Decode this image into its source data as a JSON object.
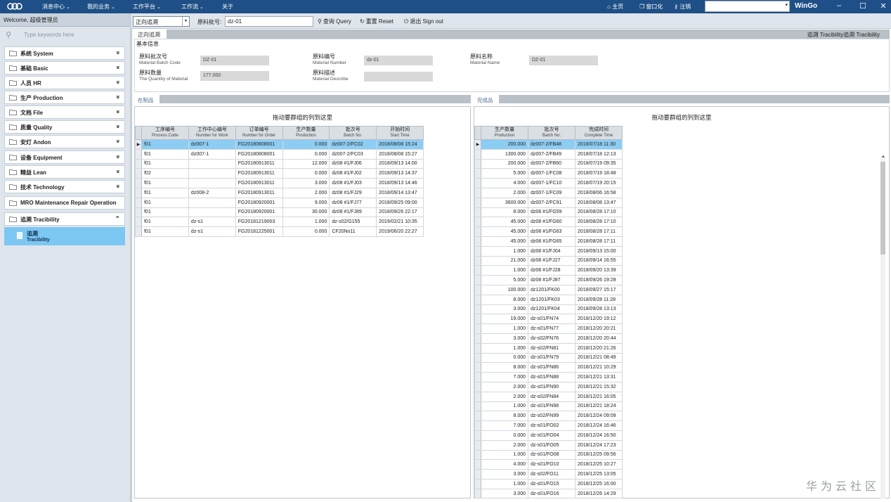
{
  "topbar": {
    "menus": [
      "消息中心",
      "我的业务",
      "工作平台",
      "工作流",
      "关于"
    ],
    "home": "主页",
    "windowize": "窗口化",
    "logout": "注销",
    "brand": "WinGo"
  },
  "sidebar": {
    "welcome": "Welcome, 超级管理员",
    "search_placeholder": "Type keywords here",
    "items": [
      {
        "zh": "系统",
        "en": "System"
      },
      {
        "zh": "基础",
        "en": "Basic"
      },
      {
        "zh": "人员",
        "en": "HR"
      },
      {
        "zh": "生产",
        "en": "Production"
      },
      {
        "zh": "文档",
        "en": "File"
      },
      {
        "zh": "质量",
        "en": "Quality"
      },
      {
        "zh": "安灯",
        "en": "Andon"
      },
      {
        "zh": "设备",
        "en": "Equipment"
      },
      {
        "zh": "精益",
        "en": "Lean"
      },
      {
        "zh": "技术",
        "en": "Technology"
      },
      {
        "zh": "MRO",
        "en": "Maintenance Repair Operation"
      },
      {
        "zh": "追溯",
        "en": "Tracibility"
      }
    ],
    "sub_item": {
      "zh": "追溯",
      "en": "Tracibility"
    }
  },
  "toolbar": {
    "mode": "正向追溯",
    "batch_label": "原料批号:",
    "batch_value": "dz-01",
    "query": "查询 Query",
    "reset": "重置 Reset",
    "signout": "退出 Sign out"
  },
  "tabs": {
    "active": "正向追溯",
    "right": "追溯  Tracibility追溯  Tracibility"
  },
  "basic_info": {
    "title": "基本信息",
    "fields": [
      {
        "zh": "原料批次号",
        "en": "Material Batch Code",
        "value": "DZ-01"
      },
      {
        "zh": "原料编号",
        "en": "Material Number",
        "value": "dz-01"
      },
      {
        "zh": "原料名称",
        "en": "Material Name",
        "value": "DZ-01"
      },
      {
        "zh": "原料数量",
        "en": "The Quantity of Material",
        "value": "177.000"
      },
      {
        "zh": "原料描述",
        "en": "Material Describe",
        "value": ""
      }
    ]
  },
  "wip": {
    "tab": "在制品",
    "hint": "拖动要群组的列到这里",
    "columns": [
      {
        "zh": "工序编号",
        "en": "Process Code"
      },
      {
        "zh": "工作中心编号",
        "en": "Number for Work"
      },
      {
        "zh": "订单编号",
        "en": "Number for Order"
      },
      {
        "zh": "生产数量",
        "en": "Production"
      },
      {
        "zh": "批次号",
        "en": "Batch No."
      },
      {
        "zh": "开始时间",
        "en": "Start Time"
      }
    ],
    "rows": [
      [
        "f01",
        "dz007-1",
        "FG20180808001",
        "0.000",
        "dz007-2/FC02",
        "2018/08/08 15:24"
      ],
      [
        "f01",
        "dz007-1",
        "FG20180808001",
        "0.000",
        "dz007-2/FC03",
        "2018/08/08 15:27"
      ],
      [
        "f01",
        "",
        "FG20180913011",
        "12.000",
        "dz08 #1/FJ06",
        "2018/09/13 14:00"
      ],
      [
        "f02",
        "",
        "FG20180913011",
        "0.000",
        "dz08 #1/FJ02",
        "2018/09/13 14:37"
      ],
      [
        "f01",
        "",
        "FG20180913011",
        "3.000",
        "dz08 #1/FJ03",
        "2018/09/13 14:46"
      ],
      [
        "f01",
        "dz008-2",
        "FG20180913011",
        "2.000",
        "dz08 #1/FJ29",
        "2018/09/14 13:47"
      ],
      [
        "f01",
        "",
        "FG20180920001",
        "9.000",
        "dz08 #1/FJ77",
        "2018/09/25 09:00"
      ],
      [
        "f01",
        "",
        "FG20180920001",
        "30.000",
        "dz08 #1/FJ89",
        "2018/09/26 22:17"
      ],
      [
        "f01",
        "dz-s1",
        "FG20181219003",
        "1.000",
        "dz-s02/G155",
        "2019/02/21 10:35"
      ],
      [
        "f01",
        "dz-s1",
        "FG20181225001",
        "0.000",
        "CF20No11",
        "2019/06/20 22:27"
      ]
    ]
  },
  "finished": {
    "tab": "完成品",
    "hint": "拖动要群组的列到这里",
    "columns": [
      {
        "zh": "生产数量",
        "en": "Production"
      },
      {
        "zh": "批次号",
        "en": "Batch No."
      },
      {
        "zh": "完成时间",
        "en": "Complete Time"
      }
    ],
    "rows": [
      [
        "200.000",
        "dz007-2/FB48",
        "2018/07/18 11:30"
      ],
      [
        "1300.000",
        "dz007-2/FB49",
        "2018/07/18 12:13"
      ],
      [
        "200.000",
        "dz007-2/FB60",
        "2018/07/19 09:35"
      ],
      [
        "5.000",
        "dz007-1/FC08",
        "2018/07/19 18:48"
      ],
      [
        "4.000",
        "dz007-1/FC10",
        "2018/07/19 20:15"
      ],
      [
        "2.000",
        "dz007-1/FC09",
        "2018/08/06 16:58"
      ],
      [
        "3600.000",
        "dz007-2/FC91",
        "2018/08/08 13:47"
      ],
      [
        "8.000",
        "dz08 #1/FG59",
        "2018/08/28 17:10"
      ],
      [
        "45.000",
        "dz08 #1/FG60",
        "2018/08/28 17:10"
      ],
      [
        "45.000",
        "dz08 #1/FG63",
        "2018/08/28 17:11"
      ],
      [
        "45.000",
        "dz08 #1/FG65",
        "2018/08/28 17:11"
      ],
      [
        "1.000",
        "dz08 #1/FJ04",
        "2018/09/13 15:00"
      ],
      [
        "21.000",
        "dz08 #1/FJ27",
        "2018/09/14 16:55"
      ],
      [
        "1.000",
        "dz08 #1/FJ28",
        "2018/09/20 13:39"
      ],
      [
        "5.000",
        "dz08 #1/FJ87",
        "2018/09/26 19:28"
      ],
      [
        "100.000",
        "dz1201/FK00",
        "2018/09/27 15:17"
      ],
      [
        "8.000",
        "dz1201/FK03",
        "2018/09/28 11:28"
      ],
      [
        "3.000",
        "dz1201/FK04",
        "2018/09/28 13:13"
      ],
      [
        "19.000",
        "dz-s01/FN74",
        "2018/12/20 19:12"
      ],
      [
        "1.000",
        "dz-s01/FN77",
        "2018/12/20 20:21"
      ],
      [
        "3.000",
        "dz-s02/FN76",
        "2018/12/20 20:44"
      ],
      [
        "1.000",
        "dz-s02/FN81",
        "2018/12/20 21:26"
      ],
      [
        "0.000",
        "dz-s01/FN79",
        "2018/12/21 08:49"
      ],
      [
        "8.000",
        "dz-s01/FN86",
        "2018/12/21 10:29"
      ],
      [
        "7.000",
        "dz-s01/FN88",
        "2018/12/21 13:31"
      ],
      [
        "2.000",
        "dz-s01/FN90",
        "2018/12/21 15:32"
      ],
      [
        "2.000",
        "dz-s02/FN84",
        "2018/12/21 16:05"
      ],
      [
        "1.000",
        "dz-s01/FN98",
        "2018/12/21 18:24"
      ],
      [
        "8.000",
        "dz-s02/FN99",
        "2018/12/24 09:09"
      ],
      [
        "7.000",
        "dz-s01/FO02",
        "2018/12/24 16:46"
      ],
      [
        "0.000",
        "dz-s01/FO04",
        "2018/12/24 16:50"
      ],
      [
        "2.000",
        "dz-s01/FO05",
        "2018/12/24 17:23"
      ],
      [
        "1.000",
        "dz-s01/FO08",
        "2018/12/25 09:56"
      ],
      [
        "4.000",
        "dz-s01/FO10",
        "2018/12/25 10:27"
      ],
      [
        "3.000",
        "dz-s02/FO11",
        "2018/12/25 13:05"
      ],
      [
        "1.000",
        "dz-s01/FO15",
        "2018/12/25 16:00"
      ],
      [
        "3.000",
        "dz-s01/FO16",
        "2018/12/26 14:29"
      ]
    ]
  },
  "watermark": "华为云社区",
  "colors": {
    "topbar": "#1e4f86",
    "selected_row": "#8dcdf3",
    "sidebar_active": "#7cc8f2"
  }
}
